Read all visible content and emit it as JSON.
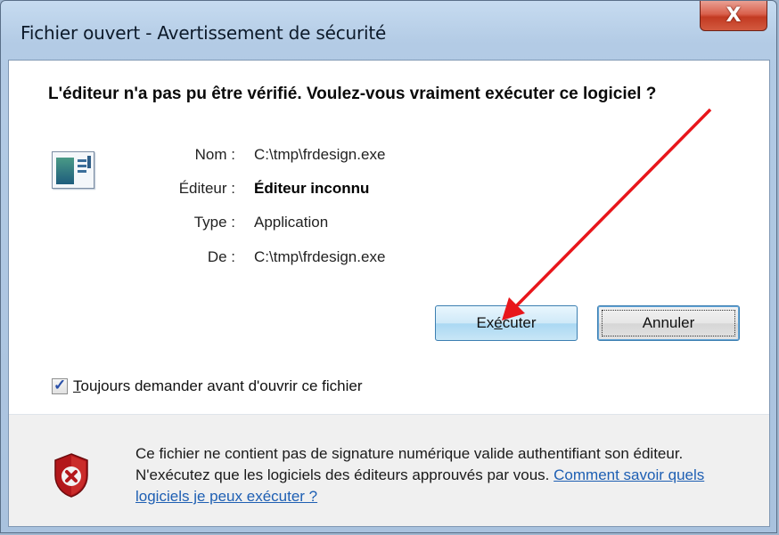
{
  "window": {
    "title": "Fichier ouvert - Avertissement de sécurité",
    "close_glyph": "X"
  },
  "heading": "L'éditeur n'a pas pu être vérifié. Voulez-vous vraiment exécuter ce logiciel ?",
  "file_info": {
    "name_label": "Nom :",
    "name_value": "C:\\tmp\\frdesign.exe",
    "publisher_label": "Éditeur :",
    "publisher_value": "Éditeur inconnu",
    "type_label": "Type :",
    "type_value": "Application",
    "from_label": "De :",
    "from_value": "C:\\tmp\\frdesign.exe"
  },
  "buttons": {
    "run_pre": "Ex",
    "run_accel": "é",
    "run_post": "cuter",
    "cancel": "Annuler"
  },
  "checkbox": {
    "checked": true,
    "check_glyph": "✓",
    "label_accel": "T",
    "label_rest": "oujours demander avant d'ouvrir ce fichier"
  },
  "notice": {
    "text": "Ce fichier ne contient pas de signature numérique valide authentifiant son éditeur. N'exécutez que les logiciels des éditeurs approuvés par vous.",
    "link": "Comment savoir quels logiciels je peux exécuter ?"
  },
  "icons": {
    "app": "application-icon",
    "shield": "security-shield-error-icon"
  },
  "colors": {
    "annotation_arrow": "#e8161b",
    "link": "#1e5fb3"
  }
}
